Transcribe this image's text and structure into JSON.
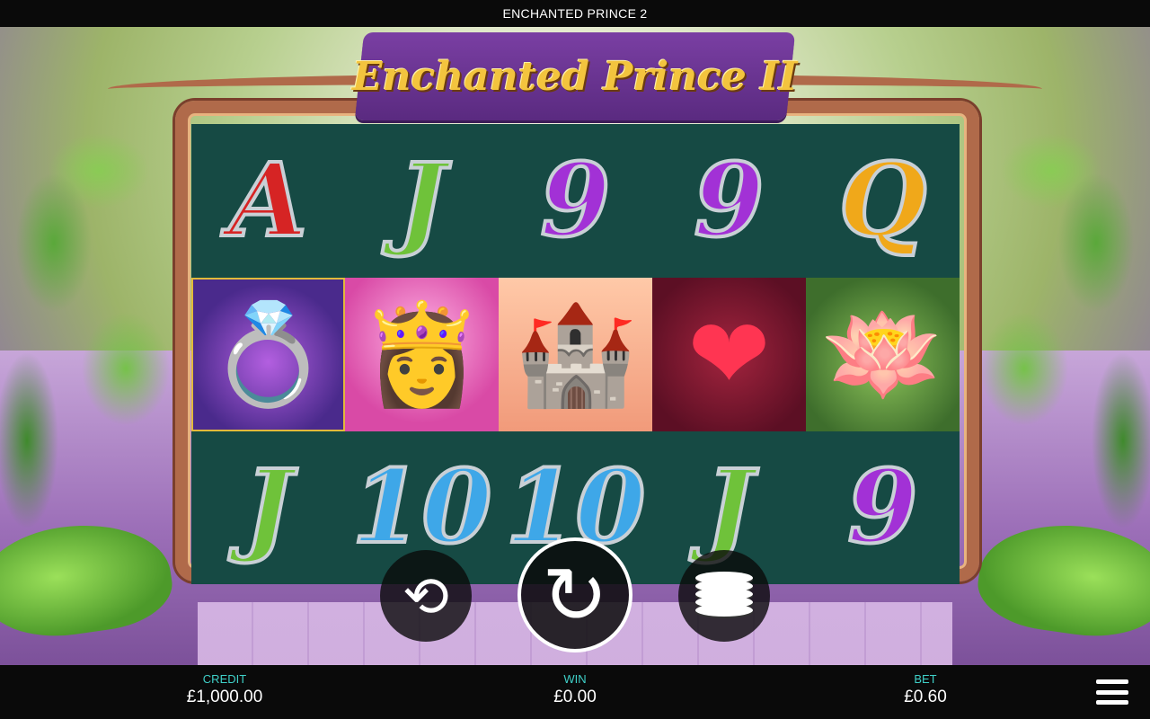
{
  "header": {
    "title": "ENCHANTED PRINCE 2"
  },
  "logo": {
    "text": "Enchanted Prince II"
  },
  "reels": [
    [
      {
        "kind": "letter",
        "text": "A",
        "color": "red"
      },
      {
        "kind": "letter",
        "text": "J",
        "color": "green"
      },
      {
        "kind": "letter",
        "text": "9",
        "color": "purple"
      },
      {
        "kind": "letter",
        "text": "9",
        "color": "purple"
      },
      {
        "kind": "letter",
        "text": "Q",
        "color": "gold"
      }
    ],
    [
      {
        "kind": "picture",
        "name": "ring",
        "glyph": "💍"
      },
      {
        "kind": "picture",
        "name": "princess",
        "glyph": "👸"
      },
      {
        "kind": "picture",
        "name": "castle",
        "glyph": "🏰"
      },
      {
        "kind": "picture",
        "name": "heart-gem",
        "glyph": "❤"
      },
      {
        "kind": "picture",
        "name": "lotus",
        "glyph": "🪷"
      }
    ],
    [
      {
        "kind": "letter",
        "text": "J",
        "color": "green"
      },
      {
        "kind": "letter",
        "text": "10",
        "color": "blue"
      },
      {
        "kind": "letter",
        "text": "10",
        "color": "blue"
      },
      {
        "kind": "letter",
        "text": "J",
        "color": "green"
      },
      {
        "kind": "letter",
        "text": "9",
        "color": "purple"
      }
    ]
  ],
  "controls": {
    "autoplay_icon": "autoplay-icon",
    "spin_icon": "spin-icon",
    "bet_icon": "coin-stack-icon"
  },
  "footer": {
    "credit": {
      "label": "CREDIT",
      "value": "£1,000.00"
    },
    "win": {
      "label": "WIN",
      "value": "£0.00"
    },
    "bet": {
      "label": "BET",
      "value": "£0.60"
    }
  }
}
